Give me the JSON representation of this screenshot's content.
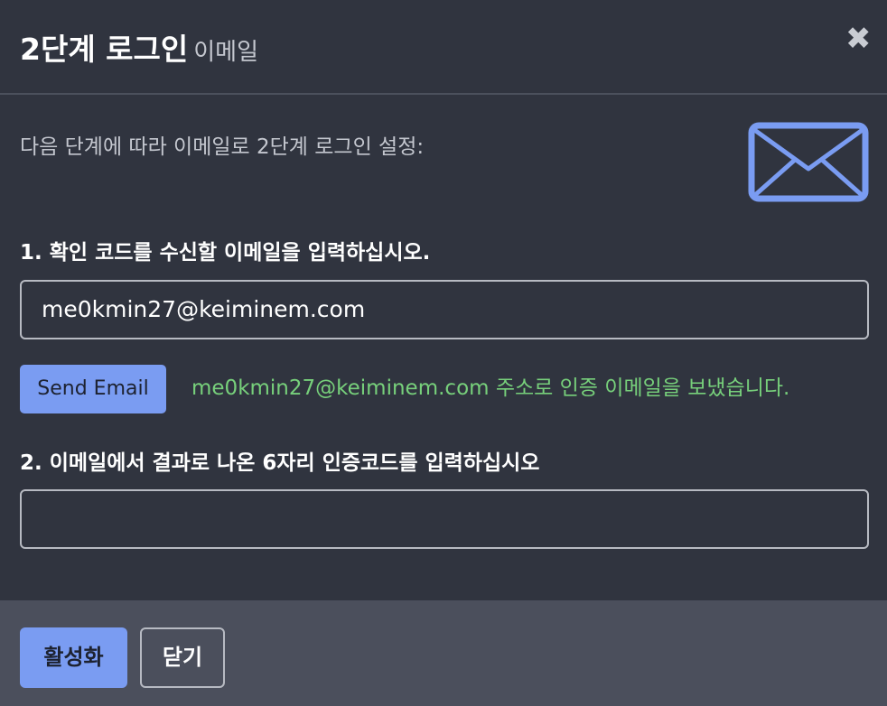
{
  "header": {
    "title": "2단계 로그인",
    "subtitle": "이메일",
    "close_symbol": "✖"
  },
  "body": {
    "intro": "다음 단계에 따라 이메일로 2단계 로그인 설정:",
    "icon": "envelope-icon",
    "step1_label": "1. 확인 코드를 수신할 이메일을 입력하십시오.",
    "email_value": "me0kmin27@keiminem.com",
    "send_button_label": "Send Email",
    "sent_message": "me0kmin27@keiminem.com 주소로 인증 이메일을 보냈습니다.",
    "step2_label": "2. 이메일에서 결과로 나온 6자리 인증코드를 입력하십시오",
    "code_value": ""
  },
  "footer": {
    "activate_label": "활성화",
    "close_label": "닫기"
  },
  "colors": {
    "background": "#30343f",
    "footer": "#4b4f5c",
    "accent": "#7a9cf2",
    "success": "#77d07b"
  }
}
